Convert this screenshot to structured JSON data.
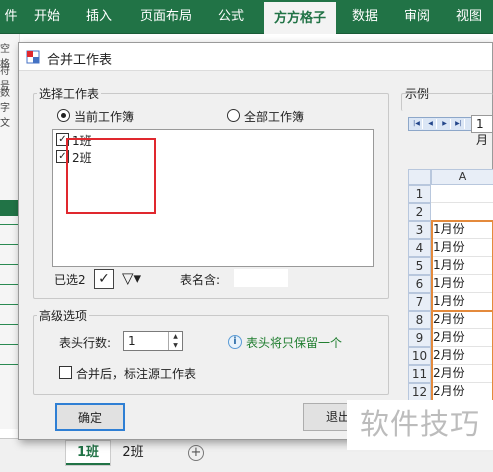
{
  "ribbon": {
    "tabs": [
      "件",
      "开始",
      "插入",
      "页面布局",
      "公式",
      "方方格子",
      "数据",
      "审阅",
      "视图"
    ],
    "active_tab": "方方格子"
  },
  "left_fragments": [
    "空格",
    "符号",
    "数字",
    "文"
  ],
  "sheet_tabs": [
    "1班",
    "2班"
  ],
  "active_sheet": "1班",
  "dialog": {
    "title": "合并工作表",
    "select_group": {
      "legend": "选择工作表",
      "radio_current": "当前工作簿",
      "radio_all": "全部工作簿",
      "selected_radio": "current",
      "sheets": [
        {
          "label": "1班",
          "checked": true
        },
        {
          "label": "2班",
          "checked": true
        }
      ],
      "selected_count_label": "已选2",
      "table_name_label": "表名含:",
      "table_name_value": ""
    },
    "advanced_group": {
      "legend": "高级选项",
      "header_rows_label": "表头行数:",
      "header_rows_value": "1",
      "info_text": "表头将只保留一个",
      "mark_source_label": "合并后，标注源工作表",
      "mark_source_checked": false
    },
    "confirm_label": "确定",
    "exit_label": "退出",
    "example": {
      "legend": "示例",
      "nav_tab": "1月",
      "column_header": "A",
      "row_numbers": [
        "1",
        "2",
        "3",
        "4",
        "5",
        "6",
        "7",
        "8",
        "9",
        "10",
        "11",
        "12",
        "13"
      ],
      "cells": [
        "",
        "",
        "1月份",
        "1月份",
        "1月份",
        "1月份",
        "1月份",
        "2月份",
        "2月份",
        "2月份",
        "2月份",
        "2月份",
        "2月份"
      ]
    }
  },
  "watermark": "软件技巧",
  "colors": {
    "excel_green": "#217346",
    "highlight_red": "#e0282e",
    "highlight_orange": "#e48a3c",
    "info_green": "#1e7d2e"
  }
}
